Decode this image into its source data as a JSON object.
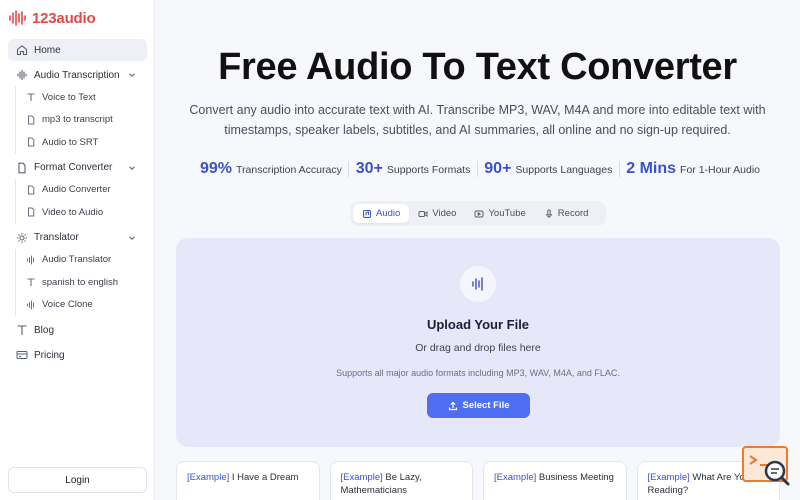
{
  "brand": {
    "name": "123audio"
  },
  "sidebar": {
    "home": "Home",
    "sections": [
      {
        "label": "Audio Transcription",
        "items": [
          "Voice to Text",
          "mp3 to transcript",
          "Audio to SRT"
        ]
      },
      {
        "label": "Format Converter",
        "items": [
          "Audio Converter",
          "Video to Audio"
        ]
      },
      {
        "label": "Translator",
        "items": [
          "Audio Translator",
          "spanish to english",
          "Voice Clone"
        ]
      }
    ],
    "blog": "Blog",
    "pricing": "Pricing",
    "login": "Login"
  },
  "main": {
    "title": "Free Audio To Text Converter",
    "subtitle": "Convert any audio into accurate text with AI. Transcribe MP3, WAV, M4A and more into editable text with timestamps, speaker labels, subtitles, and AI summaries, all online and no sign-up required.",
    "stats": [
      {
        "value": "99%",
        "label": "Transcription Accuracy"
      },
      {
        "value": "30+",
        "label": "Supports Formats"
      },
      {
        "value": "90+",
        "label": "Supports Languages"
      },
      {
        "value": "2 Mins",
        "label": "For 1-Hour Audio"
      }
    ],
    "tabs": [
      "Audio",
      "Video",
      "YouTube",
      "Record"
    ],
    "upload": {
      "title": "Upload Your File",
      "subtitle": "Or drag and drop files here",
      "hint": "Supports all major audio formats including MP3, WAV, M4A, and FLAC.",
      "button": "Select File"
    },
    "examples": [
      {
        "tag": "[Example]",
        "text": " I Have a Dream"
      },
      {
        "tag": "[Example]",
        "text": " Be Lazy, Mathematicians"
      },
      {
        "tag": "[Example]",
        "text": " Business Meeting"
      },
      {
        "tag": "[Example]",
        "text": " What Are You Reading?"
      }
    ]
  },
  "colors": {
    "accent": "#3c52c8",
    "button": "#4f6ef2",
    "logo": "#e54848",
    "upload_bg": "#e6e8fa"
  },
  "icons": [
    "logo-waveform-icon",
    "home-icon",
    "waveform-icon",
    "text-t-icon",
    "file-icon",
    "sun-icon",
    "chevron-down-icon",
    "book-icon",
    "pricing-icon",
    "music-icon",
    "video-icon",
    "youtube-icon",
    "mic-icon",
    "upload-icon"
  ]
}
